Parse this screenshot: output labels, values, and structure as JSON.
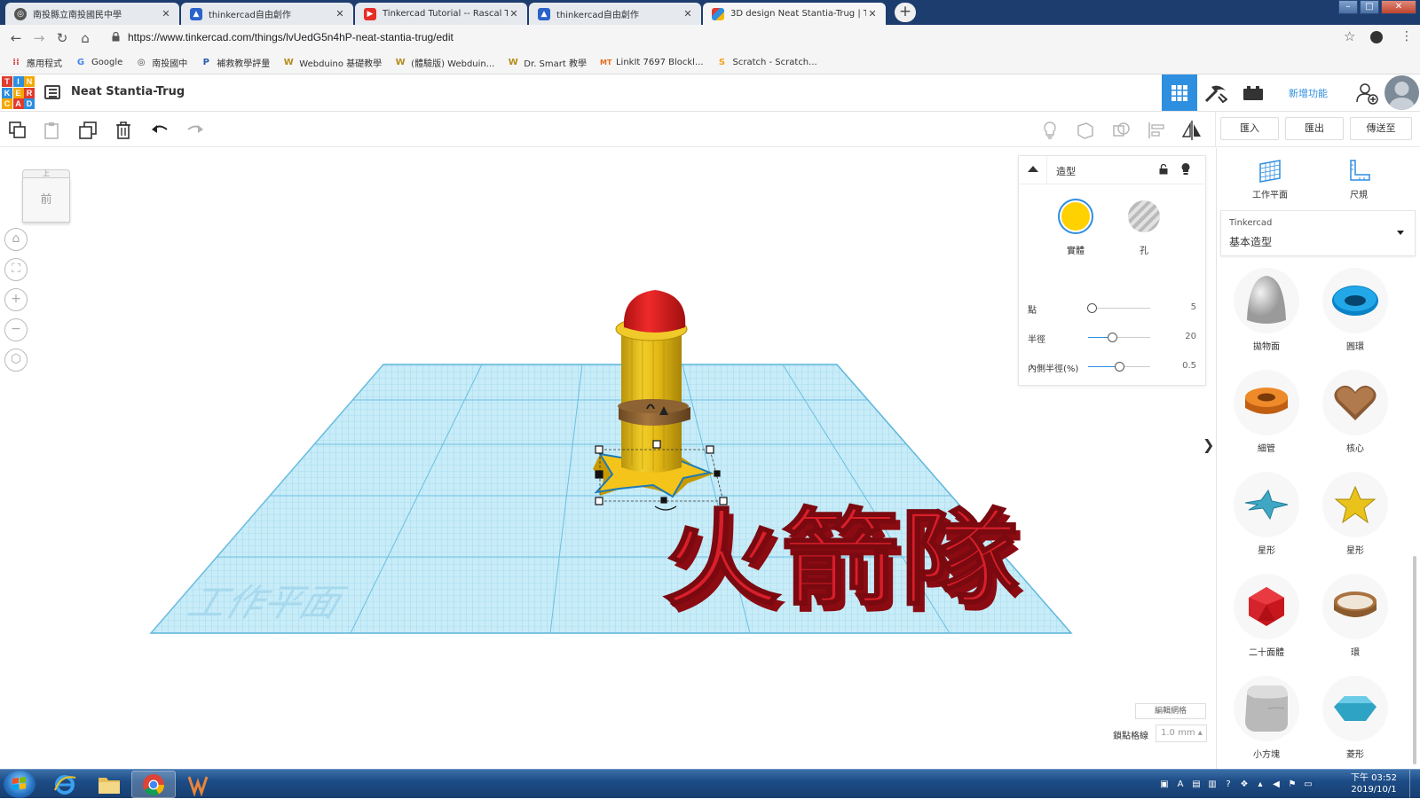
{
  "browser": {
    "tabs": [
      {
        "title": "南投縣立南投國民中學",
        "active": false,
        "icon": "globe-icon"
      },
      {
        "title": "thinkercad自由創作",
        "active": false,
        "icon": "classroom-icon"
      },
      {
        "title": "Tinkercad Tutorial -- Rascal The",
        "active": false,
        "icon": "youtube-icon"
      },
      {
        "title": "thinkercad自由創作",
        "active": false,
        "icon": "classroom-icon"
      },
      {
        "title": "3D design Neat Stantia-Trug | T",
        "active": true,
        "icon": "tinkercad-icon"
      }
    ],
    "new_tab": "+",
    "url": "https://www.tinkercad.com/things/lvUedG5n4hP-neat-stantia-trug/edit",
    "bookmarks": [
      {
        "label": "應用程式",
        "icon": "apps-icon"
      },
      {
        "label": "Google",
        "icon": "google-icon"
      },
      {
        "label": "南投國中",
        "icon": "globe-icon"
      },
      {
        "label": "補救教學評量",
        "icon": "pt-icon"
      },
      {
        "label": "Webduino 基礎教學",
        "icon": "webduino-icon"
      },
      {
        "label": "(體驗版) Webduin...",
        "icon": "webduino-icon"
      },
      {
        "label": "Dr. Smart 教學",
        "icon": "webduino-icon"
      },
      {
        "label": "LinkIt 7697 Blockl...",
        "icon": "mt-icon"
      },
      {
        "label": "Scratch - Scratch...",
        "icon": "scratch-icon"
      }
    ]
  },
  "app": {
    "design_name": "Neat Stantia-Trug",
    "logo_letters": [
      "T",
      "I",
      "N",
      "K",
      "E",
      "R",
      "C",
      "A",
      "D"
    ],
    "new_features": "新增功能",
    "import_label": "匯入",
    "export_label": "匯出",
    "send_label": "傳送至"
  },
  "viewcube": {
    "top": "上",
    "front": "前"
  },
  "workplane": {
    "watermark": "工作平面",
    "model_text": "火箭隊"
  },
  "inspector": {
    "title": "造型",
    "solid_label": "實體",
    "hole_label": "孔",
    "solid_color": "#FFD100",
    "props": [
      {
        "label": "點",
        "value": "5",
        "fraction": 0.05
      },
      {
        "label": "半徑",
        "value": "20",
        "fraction": 0.38
      },
      {
        "label": "內側半徑(%)",
        "value": "0.5",
        "fraction": 0.5
      }
    ]
  },
  "grid": {
    "edit_grid": "編輯網格",
    "snap_label": "鎖點格線",
    "snap_value": "1.0 mm ▴"
  },
  "right_panel": {
    "workplane_tool": "工作平面",
    "ruler_tool": "尺規",
    "category_top": "Tinkercad",
    "category_main": "基本造型",
    "shapes": [
      {
        "label": "拋物面",
        "icon": "paraboloid-icon"
      },
      {
        "label": "圓環",
        "icon": "torus-icon"
      },
      {
        "label": "細管",
        "icon": "tube-icon"
      },
      {
        "label": "核心",
        "icon": "heart-icon"
      },
      {
        "label": "星形",
        "icon": "star-blue-icon"
      },
      {
        "label": "星形",
        "icon": "star-yellow-icon"
      },
      {
        "label": "二十面體",
        "icon": "icosahedron-icon"
      },
      {
        "label": "環",
        "icon": "ring-icon"
      },
      {
        "label": "小方塊",
        "icon": "rounded-box-icon"
      },
      {
        "label": "菱形",
        "icon": "diamond-icon"
      }
    ]
  },
  "taskbar": {
    "time": "下午 03:52",
    "date": "2019/10/1"
  }
}
